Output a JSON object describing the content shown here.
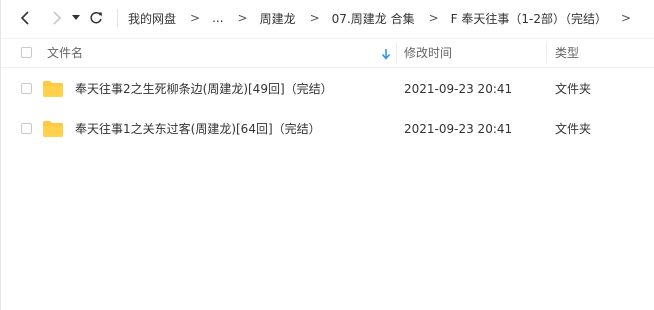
{
  "breadcrumb": {
    "items": [
      "我的网盘",
      "...",
      "周建龙",
      "07.周建龙 合集",
      "F 奉天往事（1-2部）（完结）"
    ],
    "arrow": ">"
  },
  "icons": {
    "back": "chevron-left-icon",
    "forward": "chevron-right-icon",
    "history": "caret-down-icon",
    "refresh": "refresh-icon",
    "folder": "folder-icon",
    "sort": "sort-down-arrow-icon"
  },
  "colors": {
    "folder": "#fcc940",
    "sort_arrow": "#2d8cf0",
    "disabled_nav": "#c8c8c8"
  },
  "table": {
    "columns": {
      "name": "文件名",
      "modified": "修改时间",
      "type": "类型"
    },
    "sort_column": "name",
    "rows": [
      {
        "name": "奉天往事2之生死柳条边(周建龙)[49回]（完结）",
        "modified": "2021-09-23 20:41",
        "type": "文件夹"
      },
      {
        "name": "奉天往事1之关东过客(周建龙)[64回]（完结）",
        "modified": "2021-09-23 20:41",
        "type": "文件夹"
      }
    ]
  }
}
